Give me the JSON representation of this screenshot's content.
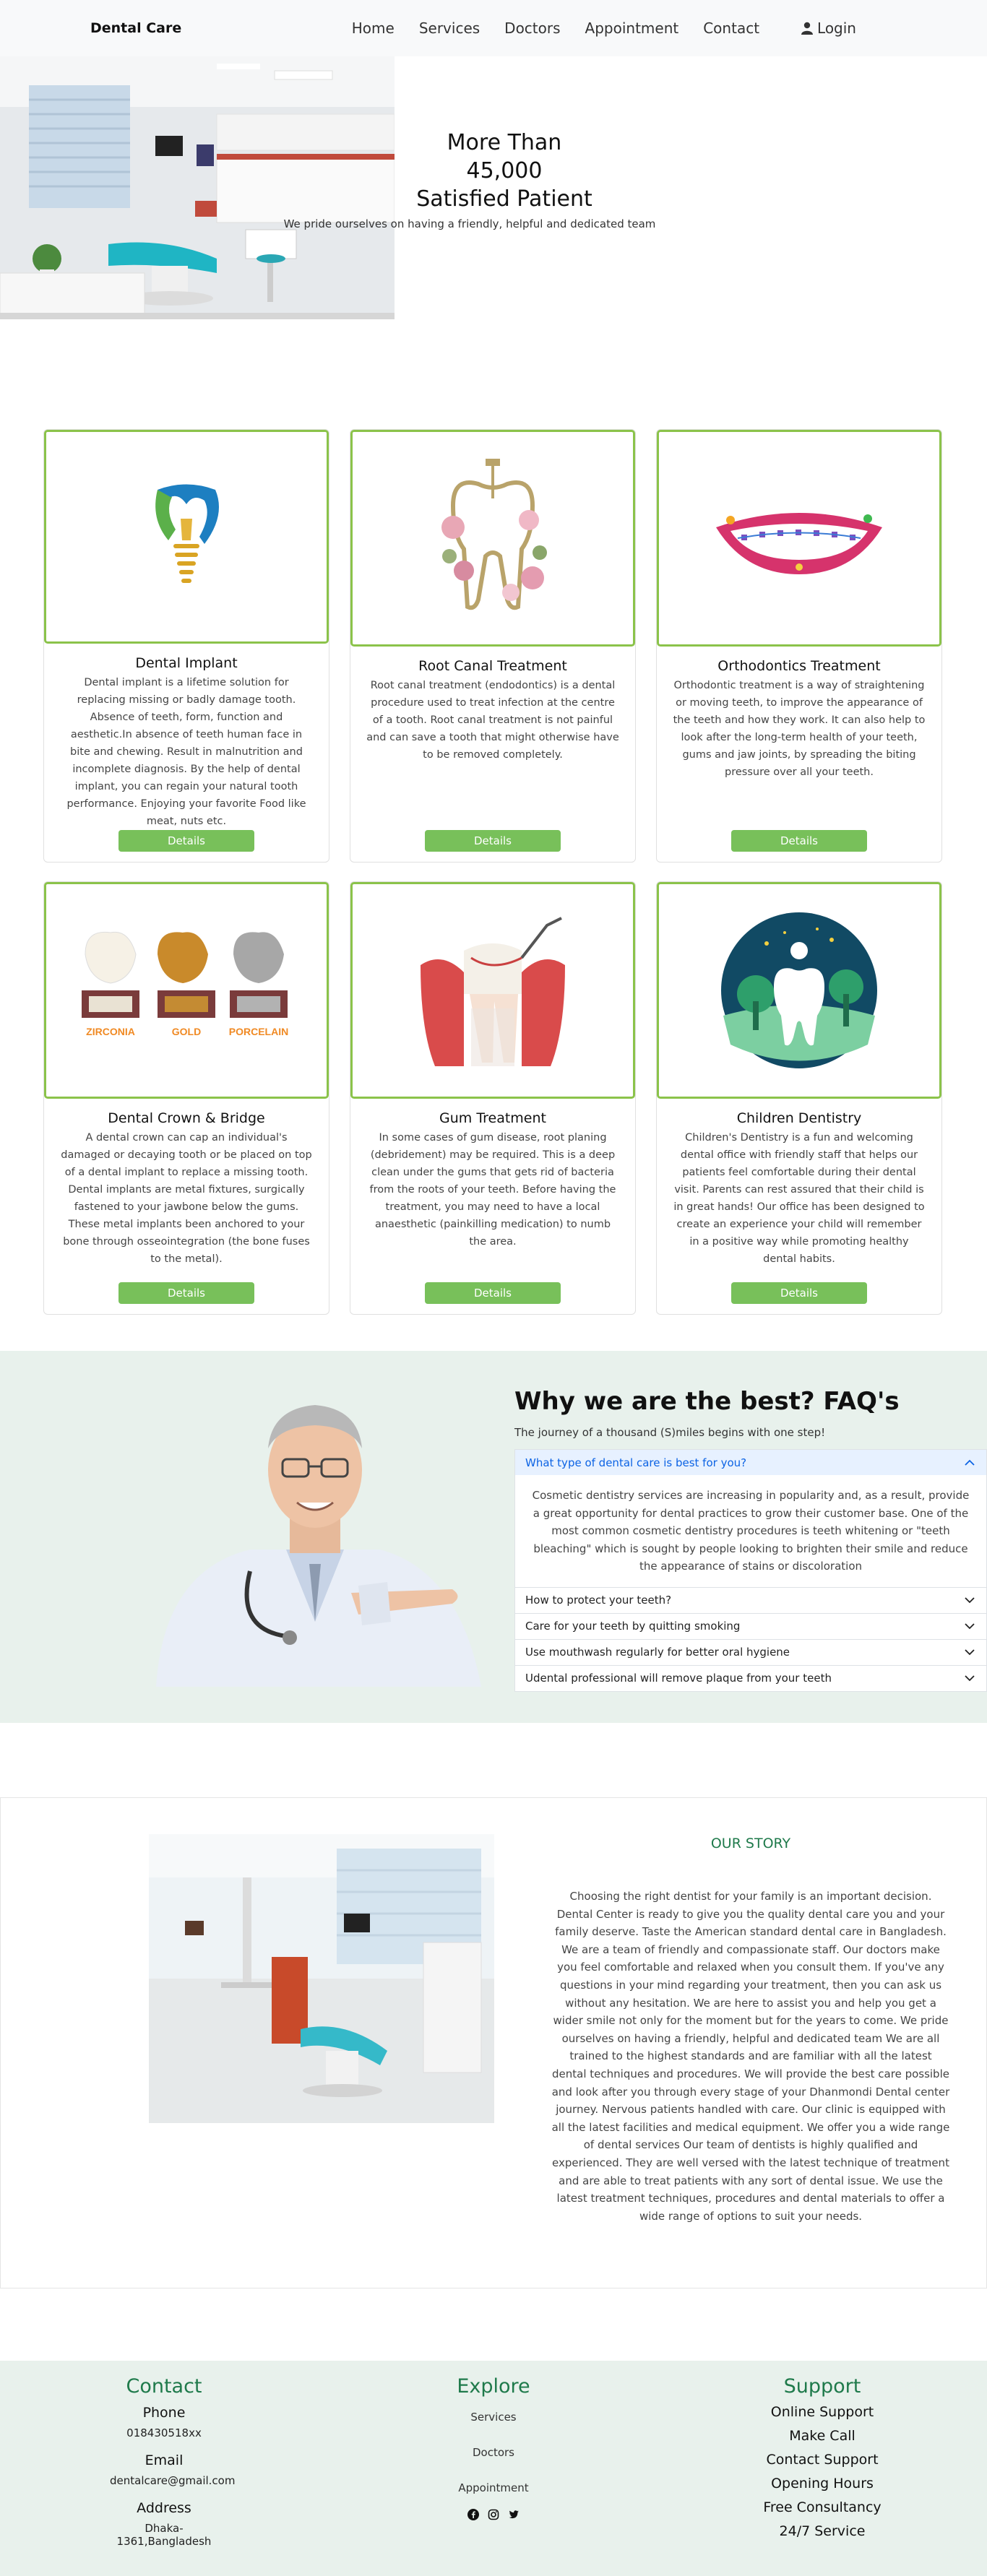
{
  "nav": {
    "brand": "Dental Care",
    "links": [
      "Home",
      "Services",
      "Doctors",
      "Appointment",
      "Contact"
    ],
    "login": "Login"
  },
  "hero": {
    "title_lines": [
      "More Than",
      "45,000",
      "Satisfied Patient"
    ],
    "subtitle": "We pride ourselves on having a friendly, helpful and dedicated team"
  },
  "services": [
    {
      "title": "Dental Implant",
      "text": "Dental implant is a lifetime solution for replacing missing or badly damage tooth. Absence of teeth, form, function and aesthetic.In absence of teeth human face in bite and chewing. Result in malnutrition and incomplete diagnosis. By the help of dental implant, you can regain your natural tooth performance. Enjoying your favorite Food like meat, nuts etc.",
      "button": "Details",
      "icon": "implant-icon"
    },
    {
      "title": "Root Canal Treatment",
      "text": "Root canal treatment (endodontics) is a dental procedure used to treat infection at the centre of a tooth. Root canal treatment is not painful and can save a tooth that might otherwise have to be removed completely.",
      "button": "Details",
      "icon": "root-canal-icon"
    },
    {
      "title": "Orthodontics Treatment",
      "text": "Orthodontic treatment is a way of straightening or moving teeth, to improve the appearance of the teeth and how they work. It can also help to look after the long-term health of your teeth, gums and jaw joints, by spreading the biting pressure over all your teeth.",
      "button": "Details",
      "icon": "braces-smile-icon"
    },
    {
      "title": "Dental Crown & Bridge",
      "text": "A dental crown can cap an individual's damaged or decaying tooth or be placed on top of a dental implant to replace a missing tooth. Dental implants are metal fixtures, surgically fastened to your jawbone below the gums. These metal implants been anchored to your bone through osseointegration (the bone fuses to the metal).",
      "button": "Details",
      "icon": "crown-icon",
      "crown_labels": [
        "ZIRCONIA",
        "GOLD",
        "PORCELAIN"
      ]
    },
    {
      "title": "Gum Treatment",
      "text": "In some cases of gum disease, root planing (debridement) may be required. This is a deep clean under the gums that gets rid of bacteria from the roots of your teeth. Before having the treatment, you may need to have a local anaesthetic (painkilling medication) to numb the area.",
      "button": "Details",
      "icon": "gum-icon"
    },
    {
      "title": "Children Dentistry",
      "text": "Children's Dentistry is a fun and welcoming dental office with friendly staff that helps our patients feel comfortable during their dental visit. Parents can rest assured that their child is in great hands! Our office has been designed to create an experience your child will remember in a positive way while promoting healthy dental habits.",
      "button": "Details",
      "icon": "child-tooth-icon"
    }
  ],
  "faq": {
    "title": "Why we are the best? FAQ's",
    "subtitle": "The journey of a thousand (S)miles begins with one step!",
    "items": [
      {
        "q": "What type of dental care is best for you?",
        "a": "Cosmetic dentistry services are increasing in popularity and, as a result, provide a great opportunity for dental practices to grow their customer base. One of the most common cosmetic dentistry procedures is teeth whitening or \"teeth bleaching\" which is sought by people looking to brighten their smile and reduce the appearance of stains or discoloration",
        "open": true
      },
      {
        "q": "How to protect your teeth?",
        "open": false
      },
      {
        "q": "Care for your teeth by quitting smoking",
        "open": false
      },
      {
        "q": "Use mouthwash regularly for better oral hygiene",
        "open": false
      },
      {
        "q": "Udental professional will remove plaque from your teeth",
        "open": false
      }
    ]
  },
  "story": {
    "title": "OUR STORY",
    "text": "Choosing the right dentist for your family is an important decision. Dental Center is ready to give you the quality dental care you and your family deserve. Taste the American standard dental care in Bangladesh. We are a team of friendly and compassionate staff. Our doctors make you feel comfortable and relaxed when you consult them. If you've any questions in your mind regarding your treatment, then you can ask us without any hesitation. We are here to assist you and help you get a wider smile not only for the moment but for the years to come. We pride ourselves on having a friendly, helpful and dedicated team We are all trained to the highest standards and are familiar with all the latest dental techniques and procedures. We will provide the best care possible and look after you through every stage of your Dhanmondi Dental center journey. Nervous patients handled with care. Our clinic is equipped with all the latest facilities and medical equipment. We offer you a wide range of dental services Our team of dentists is highly qualified and experienced. They are well versed with the latest technique of treatment and are able to treat patients with any sort of dental issue. We use the latest treatment techniques, procedures and dental materials to offer a wide range of options to suit your needs."
  },
  "footer": {
    "contact": {
      "title": "Contact",
      "phone_label": "Phone",
      "phone": "018430518xx",
      "email_label": "Email",
      "email": "dentalcare@gmail.com",
      "address_label": "Address",
      "address": "Dhaka-1361,Bangladesh"
    },
    "explore": {
      "title": "Explore",
      "items": [
        "Services",
        "Doctors",
        "Appointment"
      ]
    },
    "support": {
      "title": "Support",
      "items": [
        "Online Support",
        "Make Call",
        "Contact Support",
        "Opening Hours",
        "Free Consultancy",
        "24/7 Service"
      ]
    }
  },
  "colors": {
    "accent_green": "#78c05a",
    "dark_green": "#1f7a4b",
    "card_border": "#8bc34a",
    "section_bg": "#e8f1ec"
  }
}
